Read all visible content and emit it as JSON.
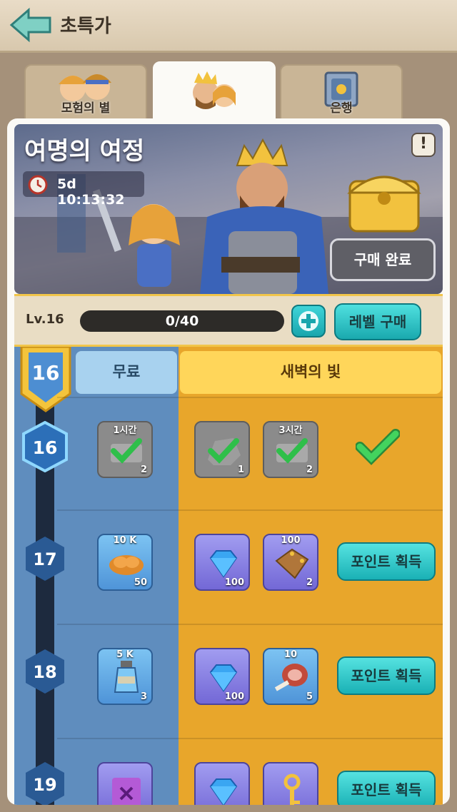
{
  "header": {
    "title": "초특가"
  },
  "tabs": [
    {
      "label": "모험의 별"
    },
    {
      "label": ""
    },
    {
      "label": "은행"
    }
  ],
  "banner": {
    "title": "여명의 여정",
    "timer": "5d 10:13:32",
    "info_label": "!",
    "purchased_label": "구매 완료"
  },
  "level_bar": {
    "level_label": "Lv.16",
    "progress_text": "0/40",
    "progress_fraction": 0.0,
    "buy_level_label": "레벨 구매"
  },
  "columns": {
    "free": "무료",
    "paid": "새벽의 빛"
  },
  "current_level": "16",
  "rows": [
    {
      "level": "16",
      "free": {
        "top": "1시간",
        "count": "2",
        "icon": "speedup-icon",
        "claimed": true
      },
      "paid": [
        {
          "top": "",
          "count": "1",
          "icon": "stone-icon",
          "claimed": true
        },
        {
          "top": "3시간",
          "count": "2",
          "icon": "speedup-icon",
          "claimed": true
        }
      ],
      "action": "claimed"
    },
    {
      "level": "17",
      "free": {
        "top": "10 K",
        "count": "50",
        "icon": "bread-icon"
      },
      "paid": [
        {
          "top": "",
          "count": "100",
          "icon": "gem-icon"
        },
        {
          "top": "100",
          "count": "2",
          "icon": "leather-icon"
        }
      ],
      "action_label": "포인트 획득"
    },
    {
      "level": "18",
      "free": {
        "top": "5 K",
        "count": "3",
        "icon": "exp-potion-icon"
      },
      "paid": [
        {
          "top": "",
          "count": "100",
          "icon": "gem-icon"
        },
        {
          "top": "10",
          "count": "5",
          "icon": "meat-icon"
        }
      ],
      "action_label": "포인트 획득"
    },
    {
      "level": "19",
      "free": {
        "top": "",
        "count": "",
        "icon": "scroll-icon"
      },
      "paid": [
        {
          "top": "",
          "count": "",
          "icon": "gem-icon"
        },
        {
          "top": "",
          "count": "",
          "icon": "key-icon"
        }
      ],
      "action_label": "포인트 획득"
    }
  ],
  "colors": {
    "accent": "#1ab1b5",
    "free_bg": "#5f8dbe",
    "paid_bg": "#e8a62b",
    "check": "#2fbf4a"
  }
}
